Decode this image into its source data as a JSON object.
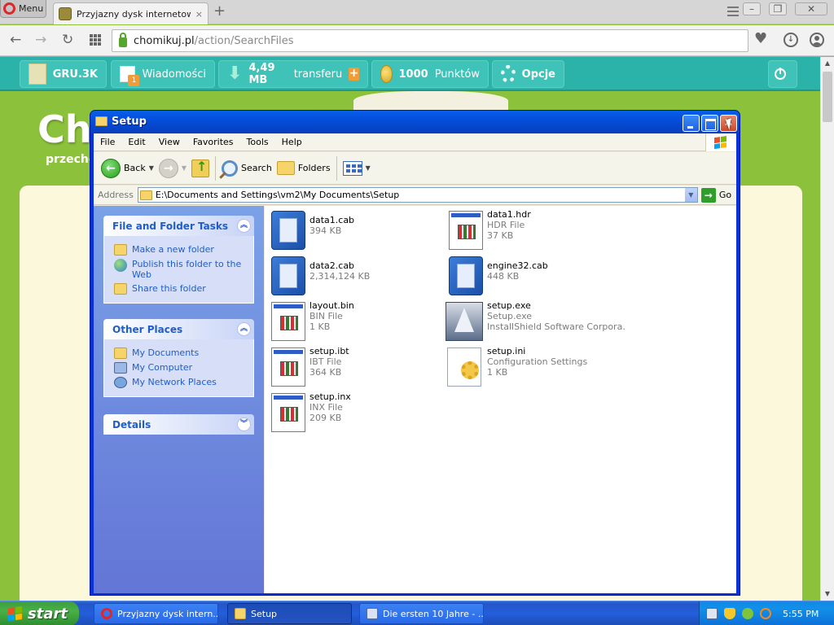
{
  "browser": {
    "menu_label": "Menu",
    "tab_title": "Przyjazny dysk internetowy",
    "tab_close": "×",
    "new_tab": "+",
    "url_host": "chomikuj.pl",
    "url_path": "/action/SearchFiles",
    "window_min": "–",
    "window_max": "❐",
    "window_close": "✕"
  },
  "site": {
    "user_label": "GRU.3K",
    "messages_label": "Wiadomości",
    "transfer_value": "4,49 MB",
    "transfer_label": "transferu",
    "points_value": "1000",
    "points_label": "Punktów",
    "options_label": "Opcje",
    "logo_text": "Cho",
    "tagline": "przecho"
  },
  "explorer": {
    "title": "Setup",
    "menu": [
      "File",
      "Edit",
      "View",
      "Favorites",
      "Tools",
      "Help"
    ],
    "toolbar": {
      "back": "Back",
      "search": "Search",
      "folders": "Folders"
    },
    "address_label": "Address",
    "address_path": "E:\\Documents and Settings\\vm2\\My Documents\\Setup",
    "go_label": "Go",
    "task_pane": {
      "file_tasks_title": "File and Folder Tasks",
      "file_tasks": [
        "Make a new folder",
        "Publish this folder to the Web",
        "Share this folder"
      ],
      "other_places_title": "Other Places",
      "other_places": [
        "My Documents",
        "My Computer",
        "My Network Places"
      ],
      "details_title": "Details"
    },
    "files": [
      {
        "name": "data1.cab",
        "type": "",
        "size": "394 KB",
        "icon": "cab-icon"
      },
      {
        "name": "data1.hdr",
        "type": "HDR File",
        "size": "37 KB",
        "icon": "document-icon"
      },
      {
        "name": "data2.cab",
        "type": "",
        "size": "2,314,124 KB",
        "icon": "cab-icon"
      },
      {
        "name": "engine32.cab",
        "type": "",
        "size": "448 KB",
        "icon": "cab-icon"
      },
      {
        "name": "layout.bin",
        "type": "BIN File",
        "size": "1 KB",
        "icon": "document-icon"
      },
      {
        "name": "setup.exe",
        "type": "Setup.exe",
        "size": "InstallShield Software Corpora...",
        "icon": "installer-icon"
      },
      {
        "name": "setup.ibt",
        "type": "IBT File",
        "size": "364 KB",
        "icon": "document-icon"
      },
      {
        "name": "setup.ini",
        "type": "Configuration Settings",
        "size": "1 KB",
        "icon": "settings-file-icon"
      },
      {
        "name": "setup.inx",
        "type": "INX File",
        "size": "209 KB",
        "icon": "document-icon"
      }
    ]
  },
  "taskbar": {
    "start_label": "start",
    "tasks": [
      "Przyjazny dysk intern...",
      "Setup",
      "Die ersten 10 Jahre - ..."
    ],
    "clock": "5:55 PM"
  }
}
